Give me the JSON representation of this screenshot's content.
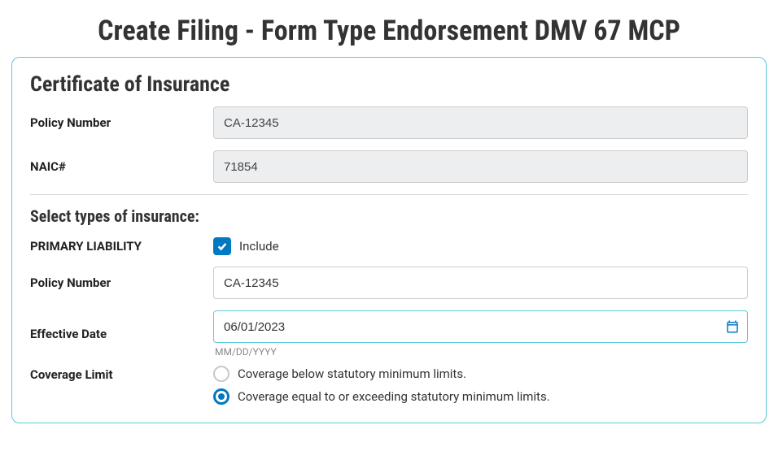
{
  "page_title": "Create Filing - Form Type Endorsement DMV 67 MCP",
  "certificate": {
    "heading": "Certificate of Insurance",
    "policy_number_label": "Policy Number",
    "policy_number_value": "CA-12345",
    "naic_label": "NAIC#",
    "naic_value": "71854"
  },
  "types": {
    "heading": "Select types of insurance:",
    "primary_liability_label": "PRIMARY LIABILITY",
    "include_label": "Include",
    "policy_number_label": "Policy Number",
    "policy_number_value": "CA-12345",
    "effective_date_label": "Effective Date",
    "effective_date_value": "06/01/2023",
    "effective_date_hint": "MM/DD/YYYY",
    "coverage_limit_label": "Coverage Limit",
    "coverage_options": {
      "below": "Coverage below statutory minimum limits.",
      "equal": "Coverage equal to or exceeding statutory minimum limits."
    }
  }
}
